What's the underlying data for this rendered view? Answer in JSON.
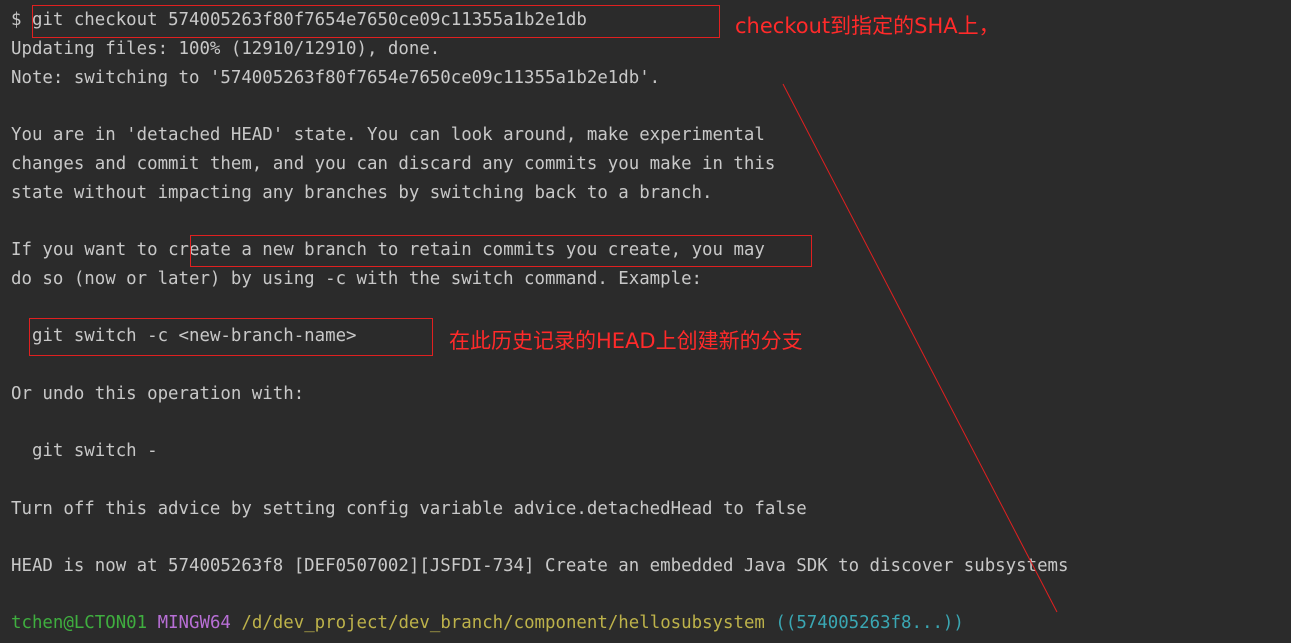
{
  "colors": {
    "background": "#2b2b2b",
    "text": "#c8c8c8",
    "annotation": "#ff2a2a",
    "prompt_user": "#3fae3f",
    "prompt_host": "#b86fd6",
    "prompt_path": "#bdb24a",
    "prompt_branch": "#3aa7b3"
  },
  "terminal": {
    "cmd_prompt": "$ ",
    "cmd": "git checkout 574005263f80f7654e7650ce09c11355a1b2e1db",
    "updating": "Updating files: 100% (12910/12910), done.",
    "note": "Note: switching to '574005263f80f7654e7650ce09c11355a1b2e1db'.",
    "detached_1": "You are in 'detached HEAD' state. You can look around, make experimental",
    "detached_2": "changes and commit them, and you can discard any commits you make in this",
    "detached_3": "state without impacting any branches by switching back to a branch.",
    "if_pre": "If you want to ",
    "if_mid": "create a new branch to retain commits you create,",
    "if_post": " you may",
    "doso": "do so (now or later) by using -c with the switch command. Example:",
    "switch_indent": "  ",
    "switch_c": "git switch -c <new-branch-name>",
    "undo": "Or undo this operation with:",
    "switch_back": "  git switch -",
    "advice": "Turn off this advice by setting config variable advice.detachedHead to false",
    "head_now": "HEAD is now at 574005263f8 [DEF0507002][JSFDI-734] Create an embedded Java SDK to discover subsystems",
    "prompt_user": "tchen@LCTON01",
    "prompt_host": "MINGW64",
    "prompt_path": "/d/dev_project/dev_branch/component/hellosubsystem",
    "prompt_branch": "((574005263f8...))"
  },
  "annotations": {
    "checkout_note": "checkout到指定的SHA上，",
    "branch_note": "在此历史记录的HEAD上创建新的分支"
  }
}
